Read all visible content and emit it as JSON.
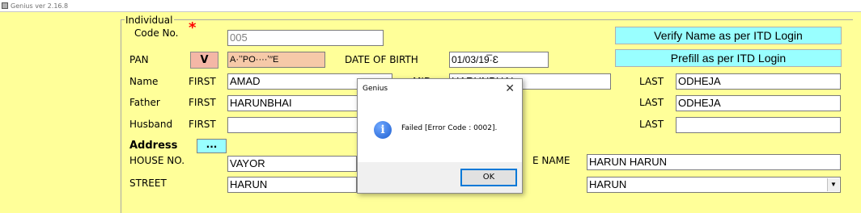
{
  "window": {
    "title": "Genius ver 2.16.8"
  },
  "form": {
    "group_title": "Individual",
    "code_no_label": "Code No.",
    "code_no_value": "005",
    "pan_label": "PAN",
    "pan_verify_button": "V",
    "pan_value": "A·ʼʼPO····ʼ′′E",
    "dob_label": "DATE OF BIRTH",
    "dob_value": "01/03/19̅·Ɛ",
    "verify_name_button": "Verify Name as per ITD Login",
    "prefill_button": "Prefill as per ITD Login",
    "name_label": "Name",
    "first_label": "FIRST",
    "mid_label": "MID",
    "last_label": "LAST",
    "name_first": "AMAD",
    "name_mid": "HARUNBHAI",
    "name_last": "ODHEJA",
    "father_label": "Father",
    "father_first": "HARUNBHAI",
    "father_last": "ODHEJA",
    "husband_label": "Husband",
    "husband_first": "",
    "husband_last": "",
    "address_label": "Address",
    "address_button": "...",
    "house_no_label": "HOUSE NO.",
    "house_no_value": "VAYOR",
    "premise_name_label": "E NAME",
    "premise_name_value": "HARUN HARUN",
    "street_label": "STREET",
    "street_value": "HARUN",
    "area_value": "HARUN"
  },
  "dialog": {
    "title": "Genius",
    "close_glyph": "✕",
    "message": "Failed [Error Code : 0002].",
    "icon": "info-icon",
    "ok_label": "OK"
  },
  "colors": {
    "background": "#ffff99",
    "cyan_button": "#99ffff",
    "pan_highlight": "#f6c9a8",
    "required_star": "#ff0000"
  }
}
